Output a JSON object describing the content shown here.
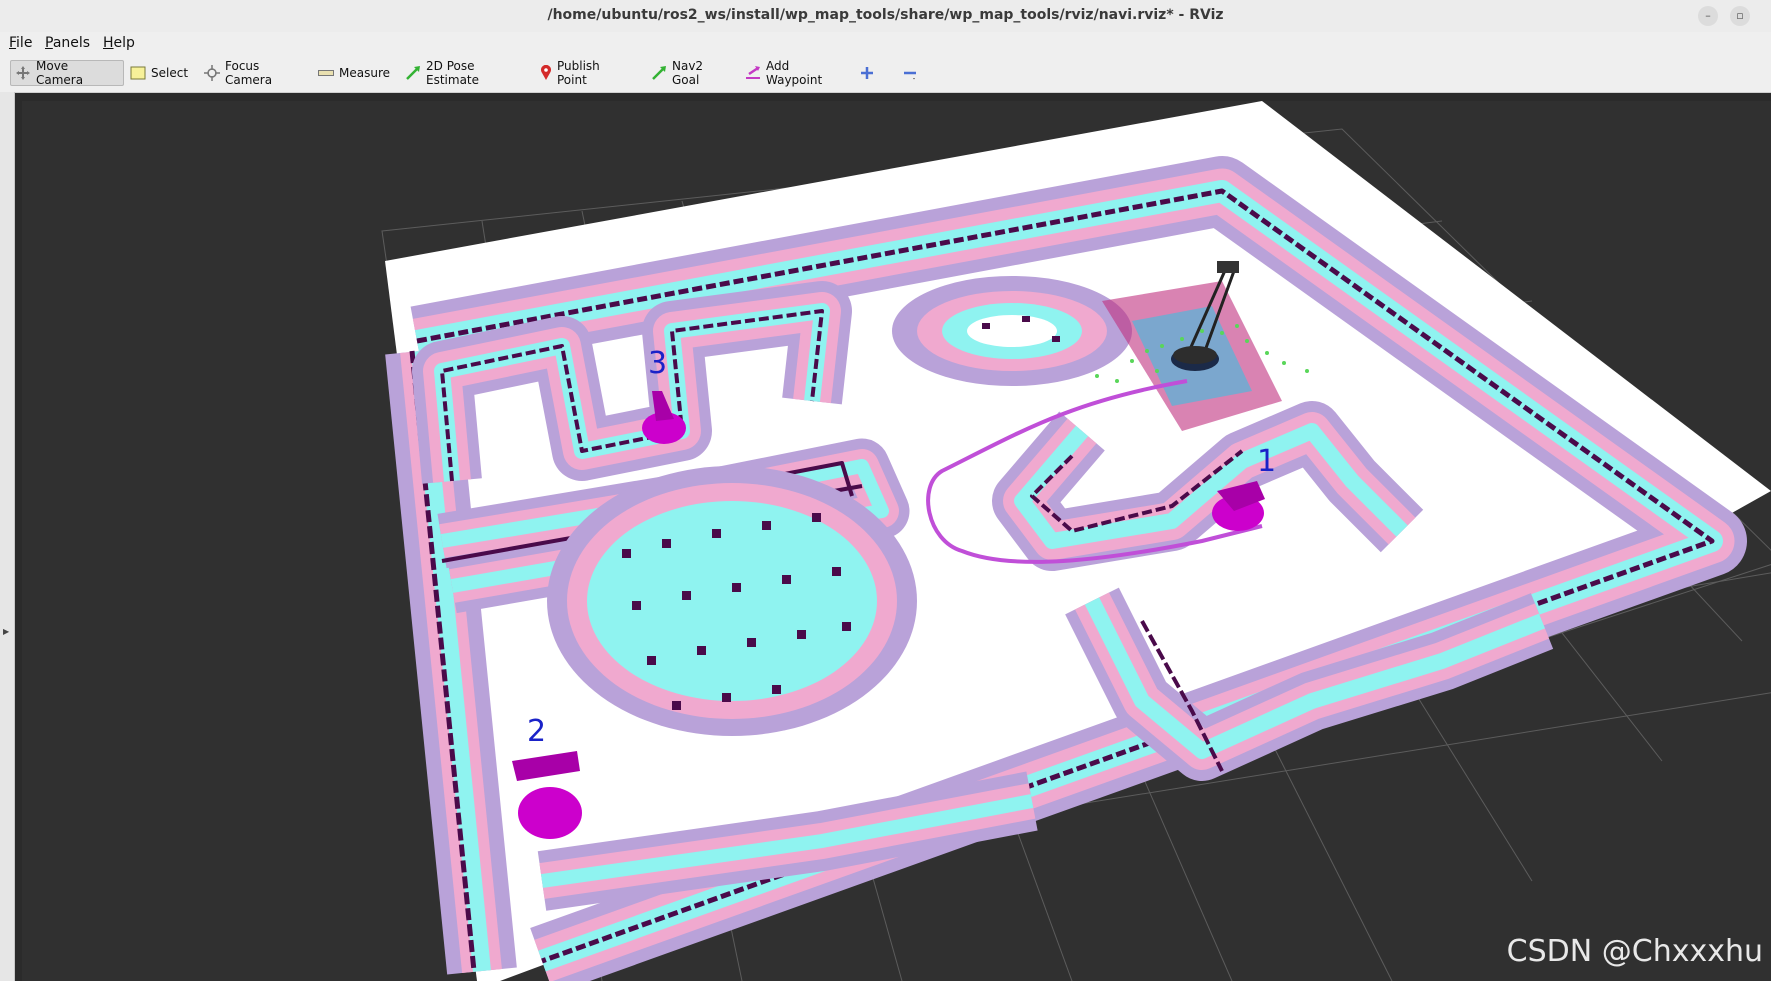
{
  "window": {
    "title": "/home/ubuntu/ros2_ws/install/wp_map_tools/share/wp_map_tools/rviz/navi.rviz* - RViz",
    "minimize_label": "–",
    "restore_label": "▫"
  },
  "menu": {
    "file": {
      "accel": "F",
      "rest": "ile"
    },
    "panels": {
      "accel": "P",
      "rest": "anels"
    },
    "help": {
      "accel": "H",
      "rest": "elp"
    }
  },
  "toolbar": {
    "tools": [
      {
        "label": "Move Camera",
        "icon": "move-camera-icon",
        "active": true
      },
      {
        "label": "Select",
        "icon": "select-icon"
      },
      {
        "label": "Focus Camera",
        "icon": "focus-camera-icon"
      },
      {
        "label": "Measure",
        "icon": "ruler-icon"
      },
      {
        "label": "2D Pose Estimate",
        "icon": "green-arrow-icon"
      },
      {
        "label": "Publish Point",
        "icon": "map-pin-icon"
      },
      {
        "label": "Nav2 Goal",
        "icon": "green-arrow-icon"
      },
      {
        "label": "Add Waypoint",
        "icon": "magenta-arrow-icon"
      },
      {
        "label": "",
        "icon": "plus-icon"
      },
      {
        "label": "",
        "icon": "minus-icon"
      }
    ]
  },
  "viewport": {
    "waypoints": [
      {
        "label": "1"
      },
      {
        "label": "2"
      },
      {
        "label": "3"
      }
    ],
    "colors": {
      "background": "#303030",
      "grid": "#5a5a5a",
      "free_space": "#ffffff",
      "inflation_outer": "#b9a2d9",
      "inflation_mid": "#f0a9cf",
      "inflation_inner": "#8ff3f0",
      "obstacle": "#4a0a4a",
      "waypoint_marker": "#cc00cc",
      "waypoint_label": "#1a22c8",
      "path": "#c04fd8"
    }
  },
  "watermark": "CSDN @Chxxxhu"
}
